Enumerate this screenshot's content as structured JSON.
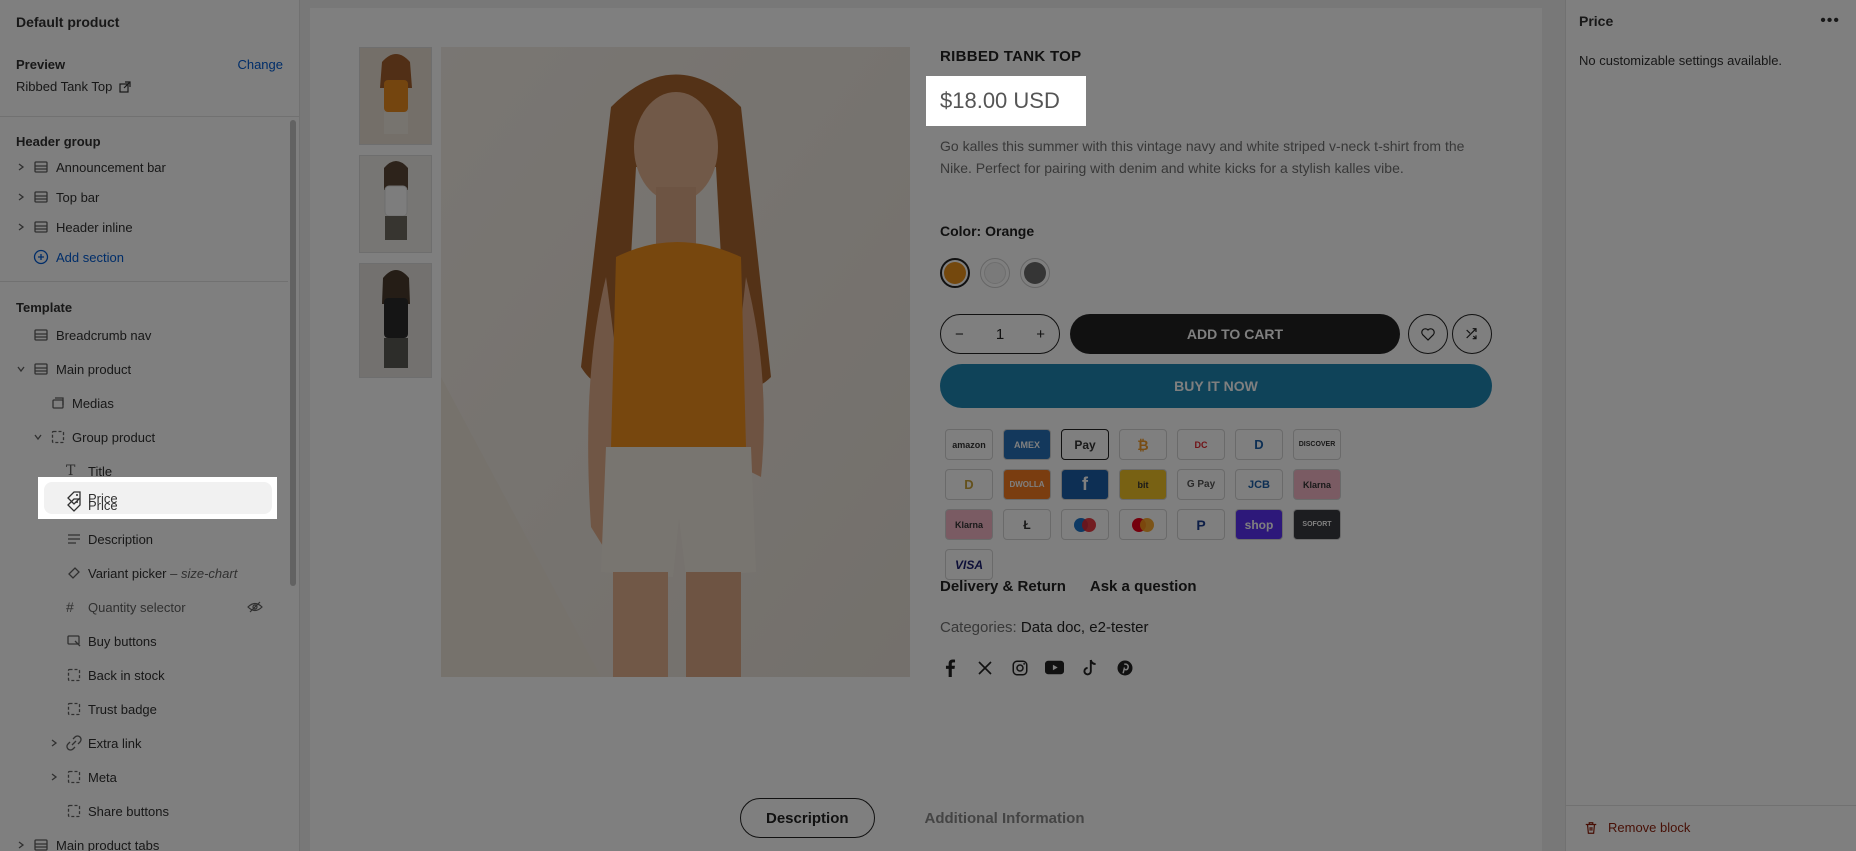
{
  "sidebar": {
    "title": "Default product",
    "preview_label": "Preview",
    "change_label": "Change",
    "preview_value": "Ribbed Tank Top",
    "header_group_label": "Header group",
    "header_items": [
      "Announcement bar",
      "Top bar",
      "Header inline"
    ],
    "add_section": "Add section",
    "template_label": "Template",
    "template_items": {
      "breadcrumb": "Breadcrumb nav",
      "main_product": "Main product",
      "medias": "Medias",
      "group_product": "Group product",
      "title": "Title",
      "price": "Price",
      "description": "Description",
      "variant_picker": "Variant picker",
      "variant_picker_suffix": "– size-chart",
      "quantity_selector": "Quantity selector",
      "buy_buttons": "Buy buttons",
      "back_in_stock": "Back in stock",
      "trust_badge": "Trust badge",
      "extra_link": "Extra link",
      "meta": "Meta",
      "share_buttons": "Share buttons",
      "main_product_tabs": "Main product tabs"
    }
  },
  "product": {
    "title": "RIBBED TANK TOP",
    "price": "$18.00 USD",
    "description": "Go kalles this summer with this vintage navy and white striped v-neck t-shirt from the Nike. Perfect for pairing with denim and white kicks for a stylish kalles vibe.",
    "color_label": "Color: Orange",
    "swatch_colors": [
      "#e8901a",
      "#f4f4f4",
      "#6a6a6a"
    ],
    "quantity": "1",
    "add_to_cart": "ADD TO CART",
    "buy_now": "BUY IT NOW",
    "payments": [
      "amazon",
      "AMEX",
      "Pay",
      "₿",
      "DC",
      "D",
      "DISCOVER",
      "D",
      "DWOLLA",
      "f",
      "bit",
      "G Pay",
      "JCB",
      "Klarna",
      "Klarna",
      "Ł",
      "maestro",
      "mc",
      "P",
      "shop",
      "SOFORT",
      "VISA"
    ],
    "link_delivery": "Delivery & Return",
    "link_question": "Ask a question",
    "categories_label": "Categories:",
    "categories_value": "Data doc, e2-tester",
    "tab_description": "Description",
    "tab_additional": "Additional Information"
  },
  "right_panel": {
    "title": "Price",
    "more": "•••",
    "message": "No customizable settings available.",
    "remove": "Remove block"
  }
}
